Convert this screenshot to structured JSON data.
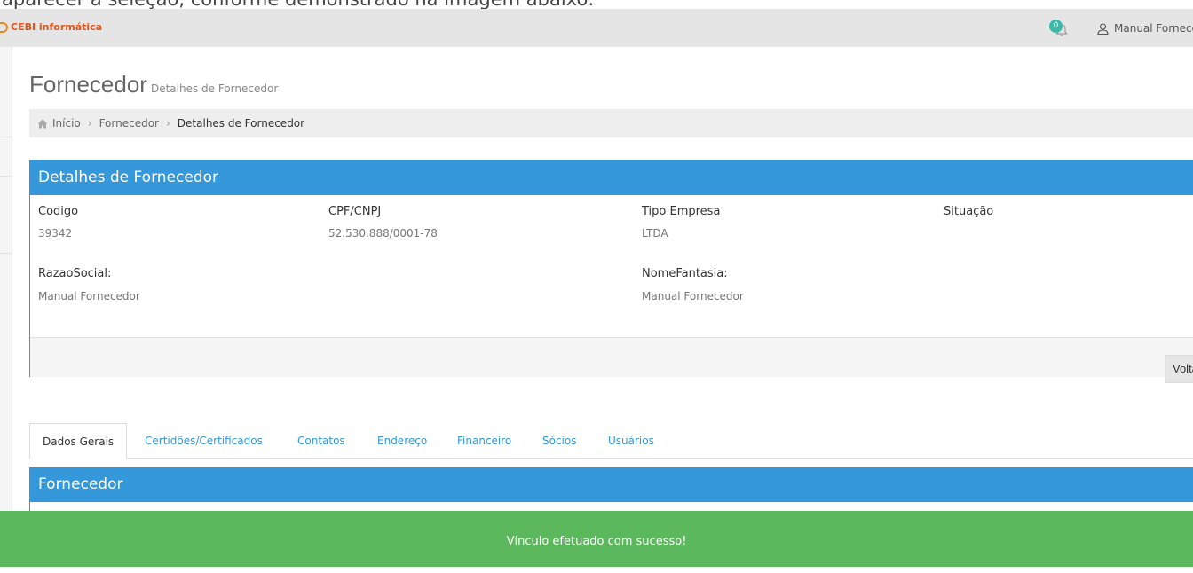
{
  "top_strip": {
    "text": "aparecer a seleção, conforme demonstrado na imagem abaixo:"
  },
  "header": {
    "brand": "CEBI informática",
    "notifications": {
      "count": "0",
      "icon": "bell-icon"
    },
    "user": {
      "name": "Manual Fornecedor",
      "icon": "user-icon"
    }
  },
  "page": {
    "title": "Fornecedor",
    "subtitle": "Detalhes de Fornecedor"
  },
  "breadcrumb": {
    "items": [
      "Início",
      "Fornecedor",
      "Detalhes de Fornecedor"
    ]
  },
  "details_panel": {
    "title": "Detalhes de Fornecedor",
    "fields": [
      {
        "label": "Codigo",
        "value": "39342"
      },
      {
        "label": "CPF/CNPJ",
        "value": "52.530.888/0001-78"
      },
      {
        "label": "Tipo Empresa",
        "value": "LTDA"
      },
      {
        "label": "Situação",
        "value": ""
      },
      {
        "label": "RazaoSocial:",
        "value": "Manual Fornecedor"
      },
      {
        "label": "NomeFantasia:",
        "value": "Manual Fornecedor"
      }
    ],
    "back_button": "Voltar"
  },
  "tabs": [
    {
      "label": "Dados Gerais",
      "active": true
    },
    {
      "label": "Certidões/Certificados",
      "active": false
    },
    {
      "label": "Contatos",
      "active": false
    },
    {
      "label": "Endereço",
      "active": false
    },
    {
      "label": "Financeiro",
      "active": false
    },
    {
      "label": "Sócios",
      "active": false
    },
    {
      "label": "Usuários",
      "active": false
    }
  ],
  "section_panel": {
    "title": "Fornecedor"
  },
  "toast": {
    "message": "Vínculo efetuado com sucesso!"
  },
  "colors": {
    "primary": "#3498db",
    "success": "#5cb85c",
    "badge": "#3bb8a6",
    "brand": "#e0541d"
  }
}
